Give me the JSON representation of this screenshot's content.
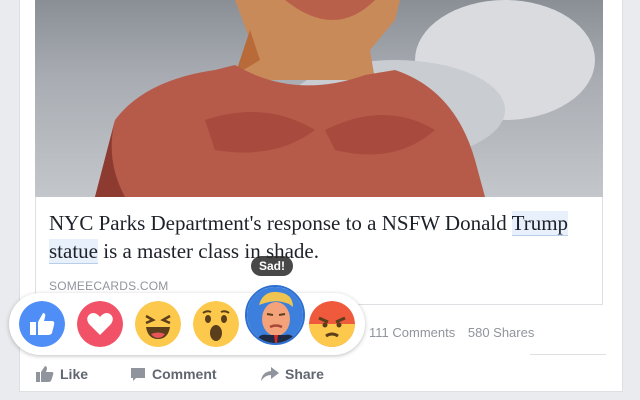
{
  "post": {
    "headline_part1": "NYC Parks Department's response to a NSFW Donald",
    "headline_highlight": "Trump statue",
    "headline_part2": " is a master class in shade.",
    "source": "SOMEECARDS.COM"
  },
  "stats": {
    "comments": "111 Comments",
    "shares": "580 Shares"
  },
  "actions": {
    "like": "Like",
    "comment": "Comment",
    "share": "Share"
  },
  "reactions": {
    "tooltip": "Sad!",
    "items": [
      "like-icon",
      "love-icon",
      "haha-icon",
      "wow-icon",
      "sad-trump-face-icon",
      "angry-icon"
    ]
  },
  "colors": {
    "like": "#4f8ef7",
    "love": "#f25268",
    "emoji_yellow": "#fcc94c",
    "angry": "#f05a3c",
    "link_blue": "#2c6fd1"
  }
}
